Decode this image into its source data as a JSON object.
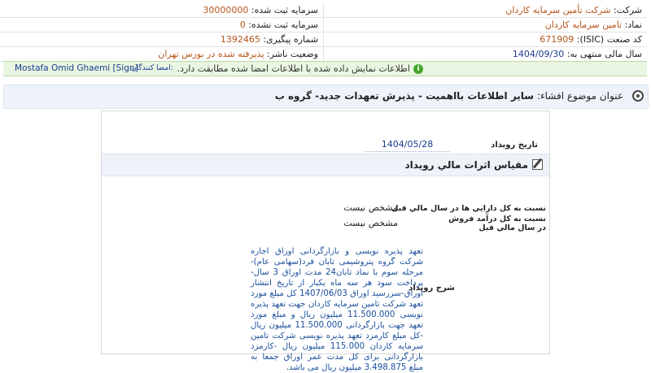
{
  "header": {
    "company_label": "شرکت:",
    "company_value": "شرکت تأمین سرمایه کاردان",
    "capital_registered_label": "سرمایه ثبت شده:",
    "capital_registered_value": "30000000",
    "symbol_label": "نماد:",
    "symbol_value": "تامین سرمایه کاردان",
    "capital_unregistered_label": "سرمایه ثبت نشده:",
    "capital_unregistered_value": "0",
    "isic_label": "کد صنعت (ISIC):",
    "isic_value": "671909",
    "tracking_label": "شماره پیگیری:",
    "tracking_value": "1392465",
    "fiscal_label": "سال مالی منتهی به:",
    "fiscal_value": "1404/09/30",
    "publisher_status_label": "وضعیت ناشر:",
    "publisher_status_value": "پذیرفته شده در بورس تهران"
  },
  "status": {
    "message": "اطلاعات نمایش داده شده با اطلاعات امضا شده مطابقت دارد.",
    "signers_label": "امضا کنندگان:",
    "signer": "Mostafa Omid Ghaemi [Sign]",
    "color": "#e9f6e1"
  },
  "title": {
    "label": "عنوان موضوع افشاء:",
    "value": "سایر اطلاعات بااهمیت - پذیرش تعهدات جدید- گروه ب"
  },
  "event": {
    "date_label": "تاریخ رویداد",
    "date_value": "1404/05/28"
  },
  "section": {
    "heading": "مقياس اثرات مالي رويداد"
  },
  "rows": [
    {
      "label": "نسبت به کل دارايي ها در سال مالي قبل",
      "value": "مشخص نیست"
    },
    {
      "label": "نسبت به کل درآمد فروش در سال مالي قبل",
      "value": "مشخص نیست"
    }
  ],
  "description": {
    "label": "شرح رويداد",
    "text": "تعهد پذیره نویسی و بازارگردانی اوراق اجاره شرکت گروه پتروشیمی تابان فرد(سهامی عام)-مرحله سوم با نماد تابان24 مدت اوراق 3 سال-پرداخت سود هر سه ماه یکبار از تاریخ انتشار اوراق-سررسید اوراق 1407/06/03 کل مبلغ مورد تعهد شرکت تامین سرمایه کاردان جهت تعهد پذیره نویسی 11.500.000 میلیون ریال و مبلغ مورد تعهد جهت بازارگردانی 11.500.000 میلیون ریال -کل مبلغ کارمزد تعهد پذیره نویسی شرکت تامین سرمایه کاردان 115.000 میلیون ریال -کارمزد بازارگردانی برای کل مدت عمر اوراق جمعا به مبلغ 3.498.875 میلیون ریال می باشد."
  }
}
